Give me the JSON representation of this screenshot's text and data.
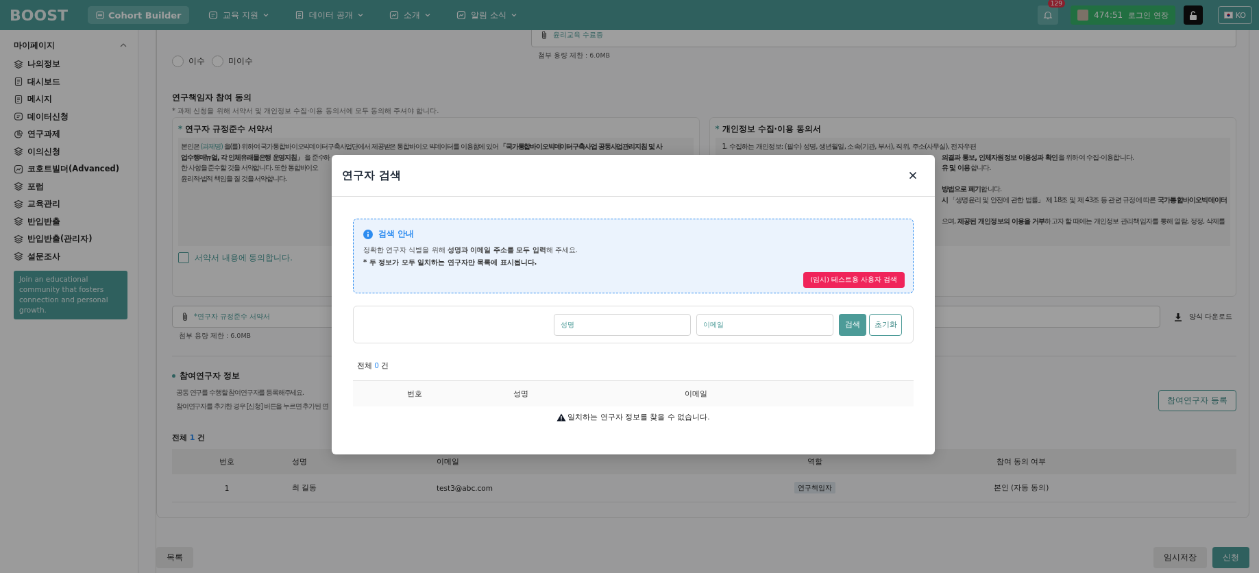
{
  "topbar": {
    "logo": "BOOST",
    "cohort_button": "Cohort Builder",
    "menus": [
      {
        "label": "교육 지원",
        "kind": "form"
      },
      {
        "label": "데이터 공개",
        "kind": "document"
      },
      {
        "label": "소개",
        "kind": "chart"
      },
      {
        "label": "알림 소식",
        "kind": "chart"
      }
    ],
    "notification_count": "129",
    "session_timer": "474:51",
    "extend_button": "로그인 연장",
    "language": "KO"
  },
  "sidebar": {
    "title": "마이페이지",
    "expanded": true,
    "items": [
      {
        "label": "나의정보",
        "kind": "layers"
      },
      {
        "label": "대시보드",
        "kind": "document"
      },
      {
        "label": "메시지",
        "kind": "document"
      },
      {
        "label": "데이터신청",
        "kind": "form"
      },
      {
        "label": "연구과제",
        "kind": "pie"
      },
      {
        "label": "이의신청",
        "kind": "layers"
      },
      {
        "label": "코호트빌더(Advanced)",
        "kind": "chart"
      },
      {
        "label": "포럼",
        "kind": "layers"
      },
      {
        "label": "교육관리",
        "kind": "layers"
      },
      {
        "label": "반입반출",
        "kind": "layers"
      },
      {
        "label": "반입반출(관리자)",
        "kind": "layers"
      },
      {
        "label": "설문조사",
        "kind": "layers"
      }
    ],
    "promo": "Join an educational community that fosters connection and personal growth."
  },
  "completion": {
    "options": [
      {
        "label": "이수",
        "selected": false
      },
      {
        "label": "미이수",
        "selected": false
      }
    ],
    "attachment": {
      "label": "윤리교육 수료증",
      "limit": "첨부 용량 제한 : 6.0MB"
    }
  },
  "consent": {
    "title": "연구책임자 참여 동의",
    "note": "* 과제 신청을 위해 서약서 및 개인정보 수집·이용 동의서에 모두 동의해 주셔야 합니다.",
    "pledge": {
      "mark": "*",
      "title": "연구자 규정준수 서약서",
      "lines": [
        [
          {
            "text": "본인은 ",
            "kind": "plain"
          },
          {
            "text": "(과제명)",
            "kind": "accent"
          },
          {
            "text": " 을(를) 위하여 국가통합바이오빅데이터구축사업단에서 제공받은 통합바이오 빅데이터를 이용함에 있어 ",
            "kind": "plain"
          },
          {
            "text": "「국가통합바이오빅데이터구축사업 공동사업관리지침 및 사",
            "kind": "bold"
          }
        ],
        [
          {
            "text": "업수행매뉴얼, 각 인체유래물은행 운영지침」",
            "kind": "bold"
          },
          {
            "text": " 을 준수하",
            "kind": "plain"
          }
        ],
        [
          {
            "text": "한 사항을 준수할 것을 서약합니다. 또한 통합바이오",
            "kind": "plain"
          }
        ],
        [
          {
            "text": "윤리적·법적 책임을 질 것을 서약합니다.",
            "kind": "plain"
          }
        ]
      ],
      "agree_label": "서약서 내용에 동의합니다.",
      "checked": false
    },
    "privacy": {
      "mark": "*",
      "title": "개인정보 수집·이용 동의서",
      "paragraphs": [
        [
          {
            "segments": [
              {
                "text": "1. 수집하는 개인정보: (필수) 성명, 생년월일, 소속(기관, 부서), 직위, 주소(사무실), 전자우편",
                "kind": "plain"
              }
            ]
          },
          {
            "hidden_start": true,
            "segments": [
              {
                "text": "의결과 통보, 인체자원정보 이용성과 확인",
                "kind": "bold"
              },
              {
                "text": "을 위하여 수집·이용합니다.",
                "kind": "plain"
              }
            ]
          },
          {
            "hidden_start": true,
            "segments": [
              {
                "text": "유 및 이용",
                "kind": "bold"
              },
              {
                "text": "합니다.",
                "kind": "plain"
              }
            ]
          }
        ],
        [
          {
            "hidden_start": true,
            "segments": [
              {
                "text": "방법으로 폐기",
                "kind": "bold"
              },
              {
                "text": "합니다.",
                "kind": "plain"
              }
            ]
          },
          {
            "hidden_start": true,
            "segments": [
              {
                "text": "시",
                "kind": "bold"
              },
              {
                "text": " 「생명윤리 및 안전에 관한 법률」 제 18조 및 제 43조 등 관련 규정에 따른 ",
                "kind": "plain"
              },
              {
                "text": "국가통합바이오빅데이터",
                "kind": "bold"
              }
            ]
          }
        ],
        [
          {
            "hidden_start": true,
            "segments": [
              {
                "text": "으며, ",
                "kind": "plain"
              },
              {
                "text": "제공된 개인정보의 이용을 거부",
                "kind": "bold"
              },
              {
                "text": "하고자 할 때에는 개인정보 관리책임자를 통해 열람, 정정, 삭제를",
                "kind": "plain"
              }
            ]
          }
        ]
      ]
    }
  },
  "pledge_attachment": {
    "label": "*연구자 규정준수 서약서",
    "limit": "첨부 용량 제한 : 6.0MB",
    "download": "양식 다운로드"
  },
  "participants": {
    "title": "참여연구자 정보",
    "notes": [
      "공동 연구를 수행할 참여연구자를 등록해주세요.",
      "참여연구자를 추가한 경우 [신청] 버튼을 누르면 추가된 연"
    ],
    "register_button": "참여연구자 등록",
    "total_label": "전체",
    "total": "1",
    "total_unit": "건",
    "columns": [
      "번호",
      "성명",
      "이메일",
      "역할",
      "참여 동의 여부"
    ],
    "rows": [
      {
        "number": "1",
        "name": "최 길동",
        "email": "test3@abc.com",
        "role": "연구책임자",
        "consent": "본인 (자동 동의)"
      }
    ]
  },
  "footer": {
    "list_button": "목록",
    "save_button": "임시저장",
    "submit_button": "신청"
  },
  "modal": {
    "title": "연구자 검색",
    "guide": {
      "title": "검색 안내",
      "text": "정확한 연구자 식별을 위해 **성명과 이메일 주소를 모두 입력**해 주세요.",
      "note": "* 두 정보가 모두 일치하는 연구자만 목록에 표시됩니다.",
      "test_button": "(임시) 테스트용 사용자 검색"
    },
    "search": {
      "name_placeholder": "성명",
      "email_placeholder": "이메일",
      "search_button": "검색",
      "reset_button": "초기화"
    },
    "total_label": "전체",
    "total": "0",
    "total_unit": "건",
    "columns": [
      "번호",
      "성명",
      "이메일"
    ],
    "empty_message": "일치하는 연구자 정보를 찾을 수 없습니다."
  }
}
